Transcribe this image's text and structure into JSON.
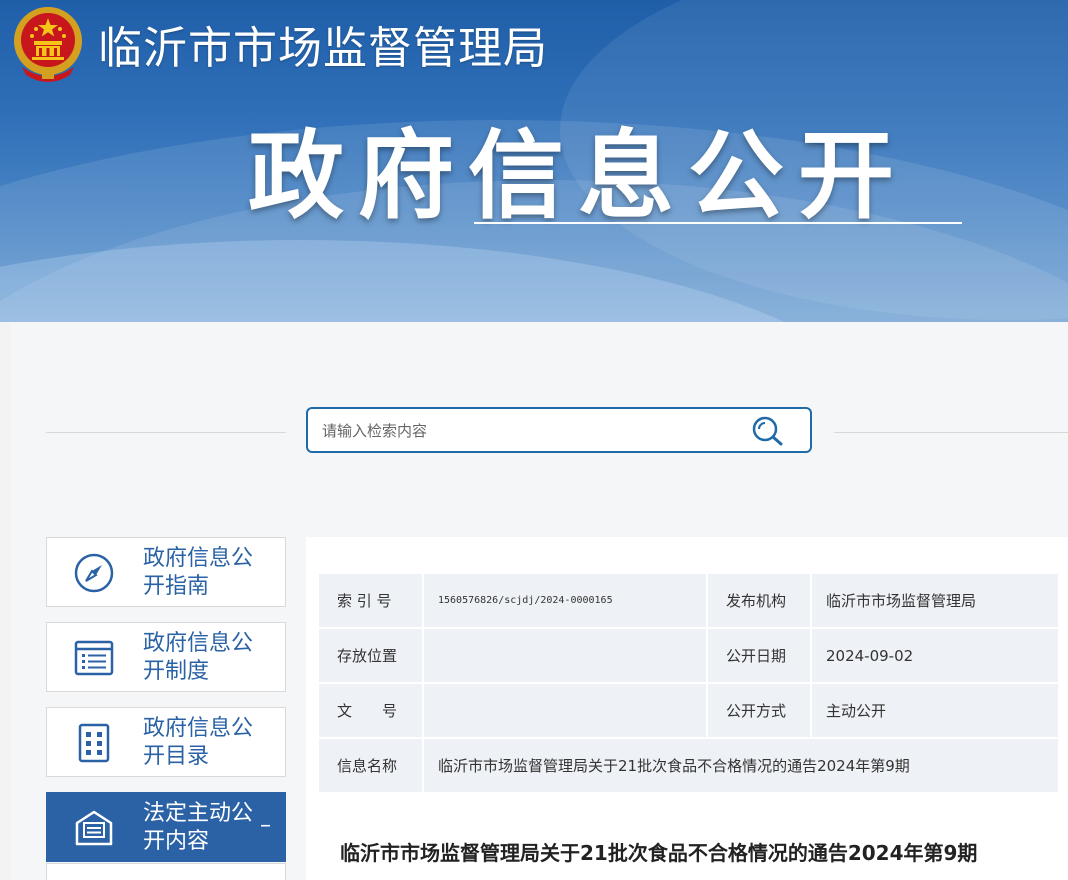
{
  "header": {
    "agency_name": "临沂市市场监督管理局",
    "banner_title": "政府信息公开"
  },
  "search": {
    "placeholder": "请输入检索内容"
  },
  "sidebar": {
    "items": [
      {
        "label": "政府信息公开指南",
        "icon": "compass-icon",
        "active": false
      },
      {
        "label": "政府信息公开制度",
        "icon": "document-list-icon",
        "active": false
      },
      {
        "label": "政府信息公开目录",
        "icon": "catalog-grid-icon",
        "active": false
      },
      {
        "label": "法定主动公开内容",
        "icon": "newspaper-icon",
        "active": true,
        "toggle": "–"
      }
    ]
  },
  "info": {
    "index_label": "索 引 号",
    "index_value": "1560576826/scjdj/2024-0000165",
    "publisher_label": "发布机构",
    "publisher_value": "临沂市市场监督管理局",
    "location_label": "存放位置",
    "location_value": "",
    "date_label": "公开日期",
    "date_value": "2024-09-02",
    "doc_no_label": "文　　号",
    "doc_no_value": "",
    "method_label": "公开方式",
    "method_value": "主动公开",
    "name_label": "信息名称",
    "name_value": "临沂市市场监督管理局关于21批次食品不合格情况的通告2024年第9期"
  },
  "article": {
    "title": "临沂市市场监督管理局关于21批次食品不合格情况的通告2024年第9期"
  },
  "colors": {
    "brand_blue": "#2b62a6",
    "banner_top": "#1f5ea8",
    "table_bg": "#eef1f5"
  }
}
